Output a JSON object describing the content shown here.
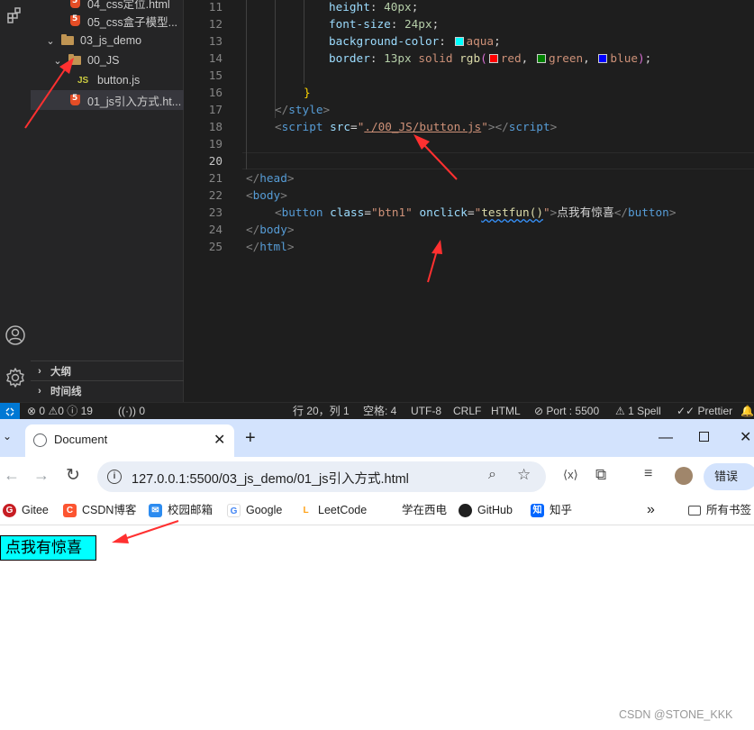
{
  "explorer": {
    "items": [
      {
        "label": "04_css定位.html",
        "icon": "html5-icon"
      },
      {
        "label": "05_css盒子模型...",
        "icon": "html5-icon"
      },
      {
        "label": "03_js_demo",
        "icon": "folder-icon"
      },
      {
        "label": "00_JS",
        "icon": "folder-open-icon"
      },
      {
        "label": "button.js",
        "icon": "js-icon",
        "badge": "JS"
      },
      {
        "label": "01_js引入方式.ht...",
        "icon": "html5-icon"
      }
    ],
    "outline_label": "大纲",
    "timeline_label": "时间线"
  },
  "editor": {
    "line_numbers": [
      "11",
      "12",
      "13",
      "14",
      "15",
      "16",
      "17",
      "18",
      "19",
      "20",
      "21",
      "22",
      "23",
      "24",
      "25"
    ],
    "active_line": "20",
    "code": {
      "l11_prop": "height",
      "l11_val": "40px",
      "l12_prop": "font-size",
      "l12_val": "24px",
      "l13_prop": "background-color",
      "l13_val": "aqua",
      "l14_prop": "border",
      "l14_num": "13px",
      "l14_solid": "solid",
      "l14_fn": "rgb",
      "l14_red": "red",
      "l14_green": "green",
      "l14_blue": "blue",
      "l16_brace": "}",
      "l17_tag": "style",
      "l18_tag": "script",
      "l18_attr": "src",
      "l18_val": "./00_JS/button.js",
      "l18_close": "script",
      "l21_tag": "head",
      "l22_tag": "body",
      "l23_tag": "button",
      "l23_attr1": "class",
      "l23_val1": "btn1",
      "l23_attr2": "onclick",
      "l23_val2": "testfun()",
      "l23_text": "点我有惊喜",
      "l23_close": "button",
      "l24_tag": "body",
      "l25_tag": "html"
    },
    "swatch_colors": {
      "aqua": "#00ffff",
      "red": "#ff0000",
      "green": "#008000",
      "blue": "#0000ff"
    }
  },
  "statusbar": {
    "errors": "0",
    "warnings": "0",
    "infos": "19",
    "ports": "0",
    "position": "行 20，列 1",
    "indent": "空格: 4",
    "encoding": "UTF-8",
    "eol": "CRLF",
    "language": "HTML",
    "port": "Port : 5500",
    "spell": "1 Spell",
    "prettier": "Prettier"
  },
  "browser": {
    "tab_title": "Document",
    "url": "127.0.0.1:5500/03_js_demo/01_js引入方式.html",
    "profile_btn": "错误",
    "bookmarks": [
      {
        "label": "Gitee",
        "color": "#c71d23",
        "glyph": "G"
      },
      {
        "label": "CSDN博客",
        "color": "#fc5531",
        "glyph": "C"
      },
      {
        "label": "校园邮箱",
        "color": "#2d8cf0",
        "glyph": "✉"
      },
      {
        "label": "Google",
        "color": "#4285f4",
        "glyph": "G"
      },
      {
        "label": "LeetCode",
        "color": "#ffa116",
        "glyph": "L"
      },
      {
        "label": "学在西电",
        "color": "#ffffff",
        "glyph": ""
      },
      {
        "label": "GitHub",
        "color": "#1f1f1f",
        "glyph": "●"
      },
      {
        "label": "知乎",
        "color": "#0066ff",
        "glyph": "知"
      }
    ],
    "all_bookmarks": "所有书签",
    "page_button": "点我有惊喜"
  },
  "watermark": "CSDN @STONE_KKK",
  "annotation_color": "#ff3030"
}
